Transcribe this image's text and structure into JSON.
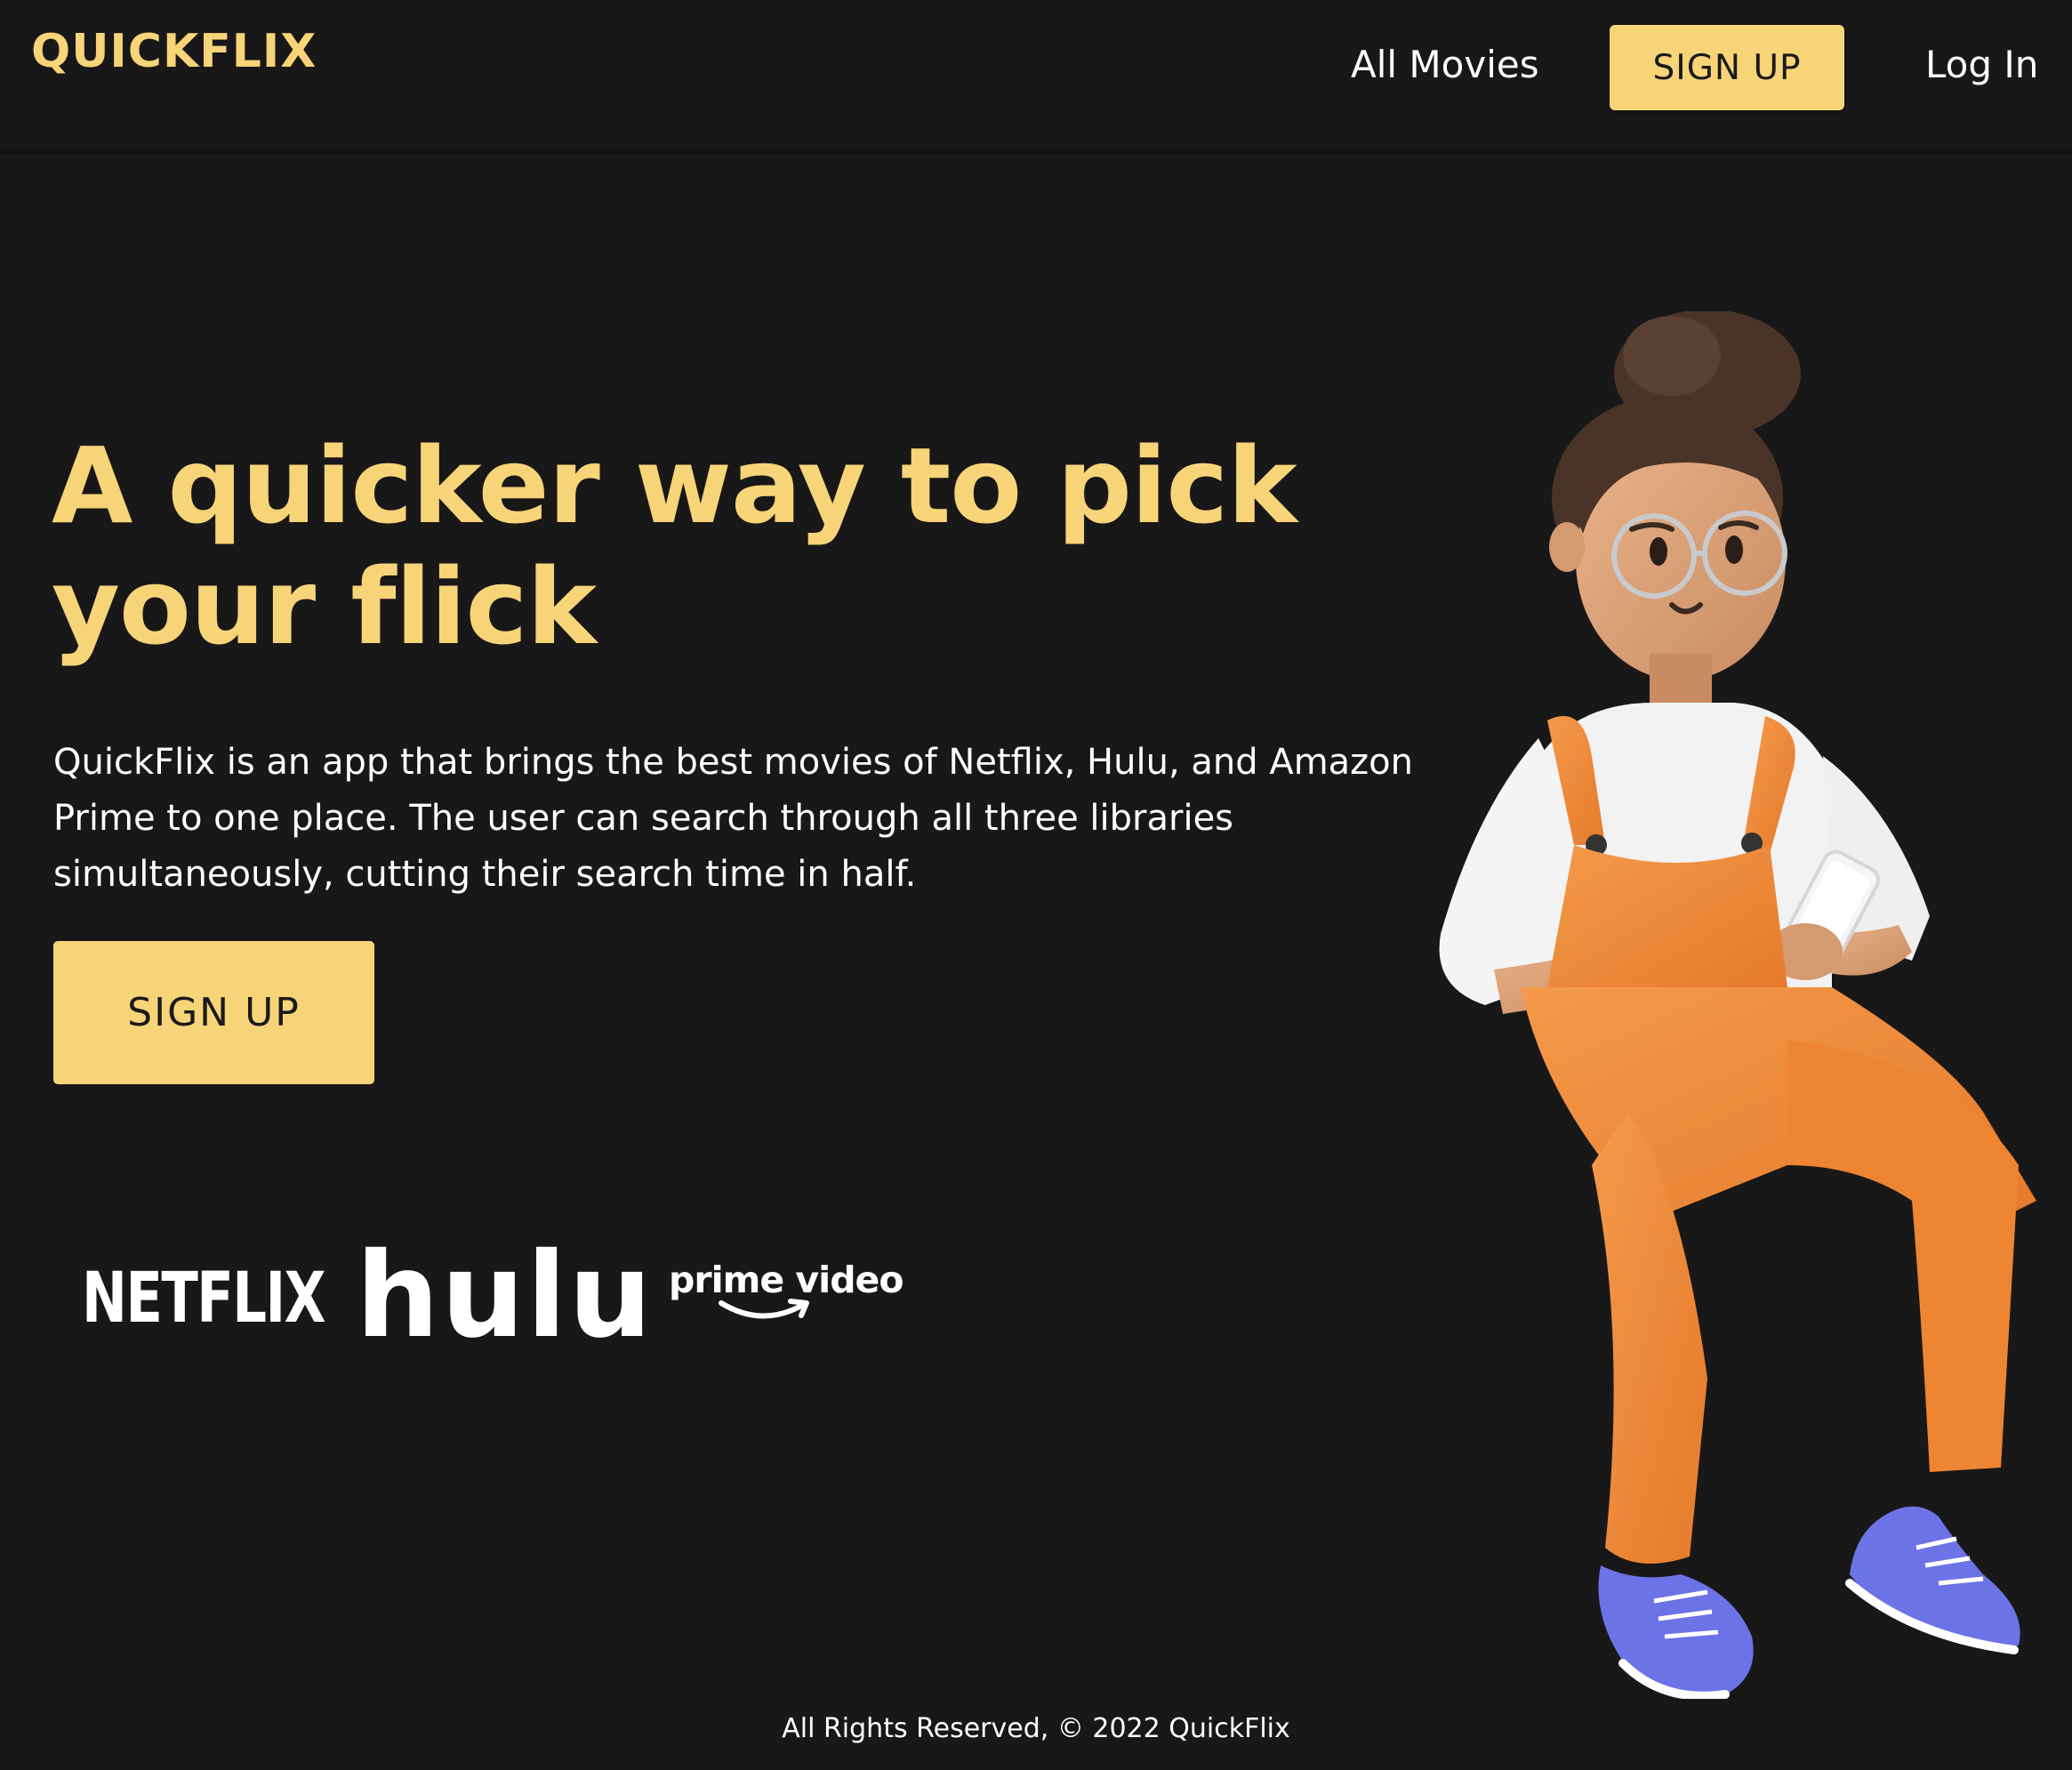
{
  "header": {
    "logo": "QUICKFLIX",
    "nav": {
      "all_movies": "All Movies",
      "sign_up": "SIGN UP",
      "log_in": "Log In"
    }
  },
  "hero": {
    "title": "A quicker way to pick your flick",
    "description": "QuickFlix is an app that brings the best movies of Netflix, Hulu, and Amazon Prime to one place. The user can search through all three libraries simultaneously, cutting their search time in half.",
    "cta_label": "SIGN UP"
  },
  "brands": {
    "netflix": "NETFLIX",
    "hulu": "hulu",
    "prime": "prime video"
  },
  "footer": {
    "text": "All Rights Reserved, © 2022 QuickFlix"
  },
  "colors": {
    "background": "#181818",
    "accent": "#F8D479",
    "text": "#ffffff",
    "overalls": "#F08A3A",
    "shoes": "#6C73E6"
  },
  "illustration": {
    "name": "3d-woman-with-phone-illustration"
  }
}
